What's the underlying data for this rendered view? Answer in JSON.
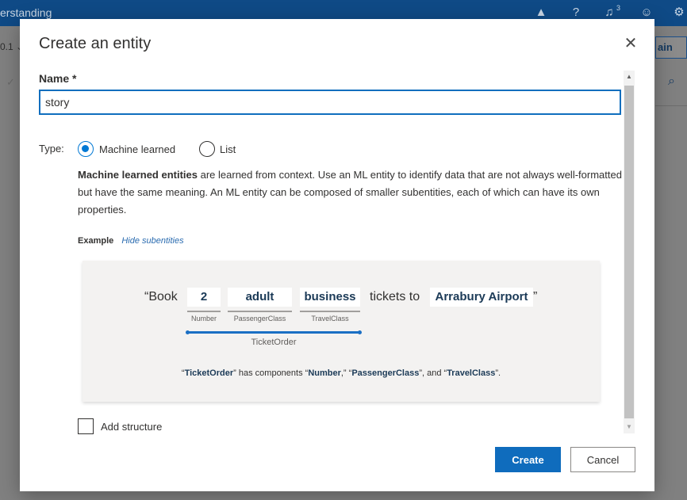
{
  "app": {
    "title": "erstanding",
    "version_fragment": "0.1",
    "train_fragment": "ain"
  },
  "dialog": {
    "title": "Create an entity",
    "name_label": "Name *",
    "name_value": "story",
    "type_label": "Type:",
    "type_options": [
      {
        "label": "Machine learned",
        "selected": true
      },
      {
        "label": "List",
        "selected": false
      }
    ],
    "description_bold": "Machine learned entities",
    "description_rest": " are learned from context. Use an ML entity to identify data that are not always well-formatted but have the same meaning. An ML entity can be composed of smaller subentities, each of which can have its own properties.",
    "example_label": "Example",
    "hide_subentities_link": "Hide subentities",
    "example": {
      "open_text": "“Book",
      "tokens": [
        {
          "text": "2",
          "label": "Number"
        },
        {
          "text": "adult",
          "label": "PassengerClass"
        },
        {
          "text": "business",
          "label": "TravelClass"
        }
      ],
      "mid_text": "tickets to",
      "destination": "Arrabury Airport",
      "close_quote": "”",
      "parent_label": "TicketOrder",
      "components_q1": "“",
      "components_entity": "TicketOrder",
      "components_q2": "” has components “",
      "components_c1": "Number",
      "components_sep1": ",” “",
      "components_c2": "PassengerClass",
      "components_sep2": "”, and “",
      "components_c3": "TravelClass",
      "components_end": "”."
    },
    "add_structure_label": "Add structure",
    "add_structure_checked": false,
    "create_button": "Create",
    "cancel_button": "Cancel"
  },
  "icons": {
    "close": "close-icon",
    "azure": "azure-icon",
    "help": "help-icon",
    "notifications": "bell-icon",
    "notifications_count": "3",
    "feedback": "smiley-icon",
    "settings": "gear-icon",
    "search": "search-icon"
  },
  "colors": {
    "accent": "#0078d4",
    "primary_button": "#0f6cbd",
    "top_bar": "#0f4a86",
    "entity_text": "#1b3a57"
  }
}
